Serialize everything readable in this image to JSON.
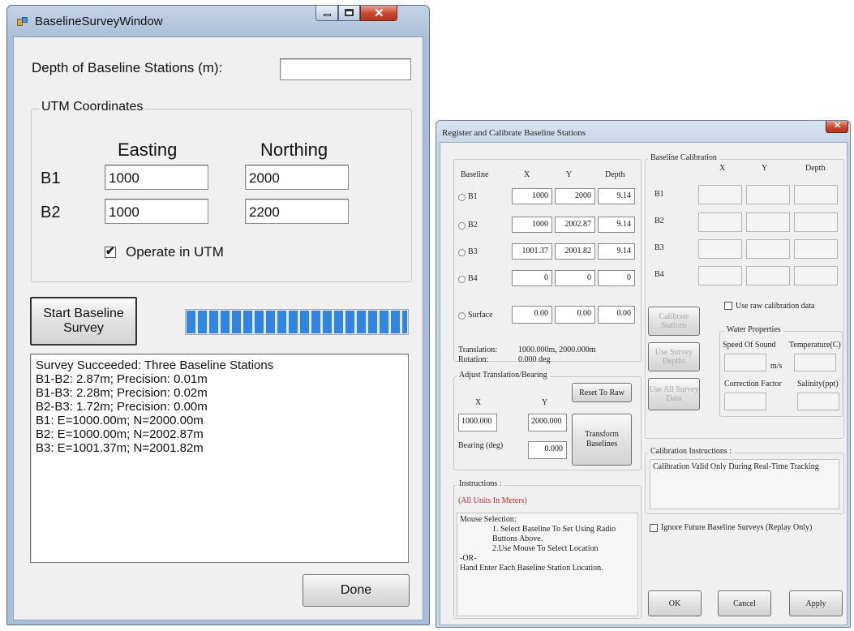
{
  "window1": {
    "title": "BaselineSurveyWindow",
    "depth_label": "Depth of Baseline Stations (m):",
    "depth_value": "",
    "utm_group": "UTM Coordinates",
    "col_easting": "Easting",
    "col_northing": "Northing",
    "rows": [
      {
        "label": "B1",
        "easting": "1000",
        "northing": "2000"
      },
      {
        "label": "B2",
        "easting": "1000",
        "northing": "2200"
      }
    ],
    "operate_utm_label": "Operate in UTM",
    "operate_utm_checked": true,
    "start_button": "Start Baseline Survey",
    "progress": 1.0,
    "log_lines": [
      "Survey Succeeded: Three Baseline Stations",
      "B1-B2: 2.87m; Precision: 0.01m",
      "B1-B3: 2.28m; Precision: 0.02m",
      "B2-B3: 1.72m; Precision: 0.00m",
      "B1: E=1000.00m; N=2000.00m",
      "B2: E=1000.00m; N=2002.87m",
      "B3: E=1001.37m; N=2001.82m"
    ],
    "done_button": "Done"
  },
  "window2": {
    "title": "Register and Calibrate Baseline Stations",
    "headers": {
      "baseline": "Baseline",
      "x": "X",
      "y": "Y",
      "depth": "Depth"
    },
    "stations": [
      {
        "label": "B1",
        "x": "1000",
        "y": "2000",
        "depth": "9.14"
      },
      {
        "label": "B2",
        "x": "1000",
        "y": "2002.87",
        "depth": "9.14"
      },
      {
        "label": "B3",
        "x": "1001.37",
        "y": "2001.82",
        "depth": "9.14"
      },
      {
        "label": "B4",
        "x": "0",
        "y": "0",
        "depth": "0"
      }
    ],
    "surface": {
      "label": "Surface",
      "x": "0.00",
      "y": "0.00",
      "depth": "0.00"
    },
    "translation_label": "Translation:",
    "translation_value": "1000.000m, 2000.000m",
    "rotation_label": "Rotation:",
    "rotation_value": "0.000 deg",
    "adjust_group": "Adjust Translation/Bearing",
    "adjust_x_label": "X",
    "adjust_y_label": "Y",
    "adjust_x_value": "1000.000",
    "adjust_y_value": "2000.000",
    "reset_button": "Reset To Raw",
    "bearing_label": "Bearing (deg)",
    "bearing_value": "0.000",
    "transform_button": "Transform Baselines",
    "instructions_group": "Instructions :",
    "instructions_units": "(All Units In Meters)",
    "instructions_lines": [
      "Mouse Selection:",
      "1. Select Baseline To Set Using Radio",
      "Buttons Above.",
      "2.Use Mouse To Select Location",
      "-OR-",
      "Hand Enter Each Baseline Station Location."
    ],
    "calib_group": "Baseline Calibration",
    "calib_headers": {
      "x": "X",
      "y": "Y",
      "depth": "Depth"
    },
    "calib_rows": [
      "B1",
      "B2",
      "B3",
      "B4"
    ],
    "use_raw_label": "Use raw calibration data",
    "calibrate_button": "Calibrate Stations",
    "use_survey_depths_button": "Use Survey Depths",
    "use_all_survey_button": "Use All Survey Data",
    "water_group": "Water Properties",
    "speed_label": "Speed Of Sound",
    "temperature_label": "Temperature(C)",
    "speed_unit": "m/s",
    "correction_label": "Correction Factor",
    "salinity_label": "Salinity(ppt)",
    "calib_instr_group": "Calibration Instructions :",
    "calib_instr_text": "Calibration Valid Only During Real-Time Tracking",
    "ignore_label": "Ignore Future Baseline Surveys (Replay Only)",
    "ok_button": "OK",
    "cancel_button": "Cancel",
    "apply_button": "Apply"
  },
  "colors": {
    "progress": "#2f86e0",
    "title_bar": "#b9cbe0",
    "close": "#c9462f"
  }
}
